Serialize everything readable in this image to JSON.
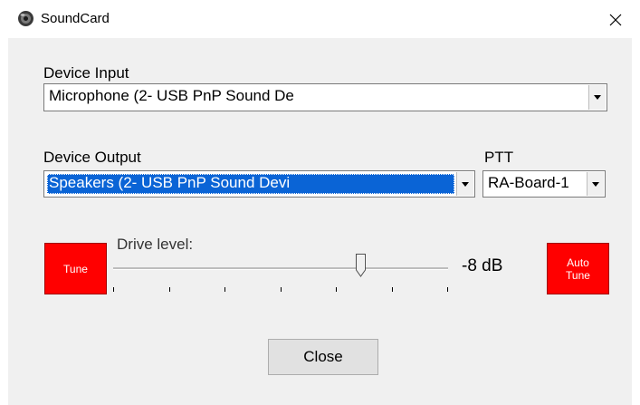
{
  "window": {
    "title": "SoundCard",
    "icon": "speaker-icon",
    "close_icon": "close-icon"
  },
  "device_input": {
    "label": "Device Input",
    "value": "Microphone (2- USB PnP Sound De"
  },
  "device_output": {
    "label": "Device Output",
    "value": "Speakers (2- USB PnP Sound Devi"
  },
  "ptt": {
    "label": "PTT",
    "value": "RA-Board-1"
  },
  "tune_button": {
    "label": "Tune"
  },
  "auto_tune_button": {
    "label_line1": "Auto",
    "label_line2": "Tune"
  },
  "drive_level": {
    "label": "Drive level:",
    "value_text": "-8 dB",
    "slider_fraction": 0.74,
    "tick_count": 7
  },
  "close_button": {
    "label": "Close"
  },
  "colors": {
    "accent_selection": "#0a64d6",
    "tune_red": "#ff0000",
    "dialog_bg": "#f0f0f0"
  }
}
